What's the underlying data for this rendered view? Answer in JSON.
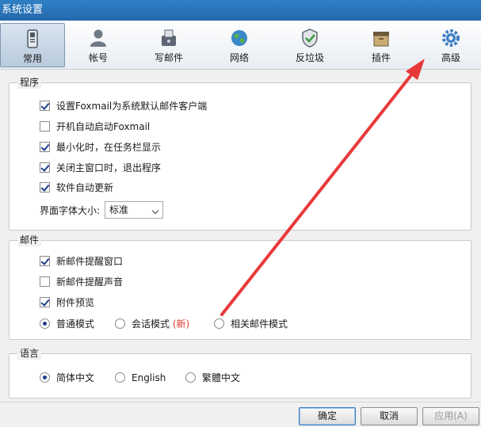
{
  "window": {
    "title": "系统设置"
  },
  "tabs": [
    {
      "label": "常用",
      "icon": "phone-icon"
    },
    {
      "label": "帐号",
      "icon": "user-icon"
    },
    {
      "label": "写邮件",
      "icon": "compose-icon"
    },
    {
      "label": "网络",
      "icon": "globe-icon"
    },
    {
      "label": "反垃圾",
      "icon": "shield-icon"
    },
    {
      "label": "插件",
      "icon": "box-icon"
    },
    {
      "label": "高级",
      "icon": "gear-icon"
    }
  ],
  "active_tab": "常用",
  "program": {
    "title": "程序",
    "options": [
      {
        "label": "设置Foxmail为系统默认邮件客户端",
        "checked": true
      },
      {
        "label": "开机自动启动Foxmail",
        "checked": false
      },
      {
        "label": "最小化时，在任务栏显示",
        "checked": true
      },
      {
        "label": "关闭主窗口时，退出程序",
        "checked": true
      },
      {
        "label": "软件自动更新",
        "checked": true
      }
    ],
    "font_size_label": "界面字体大小:",
    "font_size_value": "标准"
  },
  "mail": {
    "title": "邮件",
    "options": [
      {
        "label": "新邮件提醒窗口",
        "checked": true
      },
      {
        "label": "新邮件提醒声音",
        "checked": false
      },
      {
        "label": "附件预览",
        "checked": true
      }
    ],
    "modes": [
      {
        "label": "普通模式",
        "selected": true
      },
      {
        "label": "会话模式",
        "selected": false,
        "badge": "(新)"
      },
      {
        "label": "相关邮件模式",
        "selected": false
      }
    ]
  },
  "language": {
    "title": "语言",
    "options": [
      {
        "label": "简体中文",
        "selected": true
      },
      {
        "label": "English",
        "selected": false
      },
      {
        "label": "繁體中文",
        "selected": false
      }
    ]
  },
  "buttons": {
    "ok": "确定",
    "cancel": "取消",
    "apply": "应用(A)"
  },
  "colors": {
    "accent": "#2468ab",
    "annotation_arrow": "#e8393a",
    "badge_new": "#e03a2a"
  }
}
